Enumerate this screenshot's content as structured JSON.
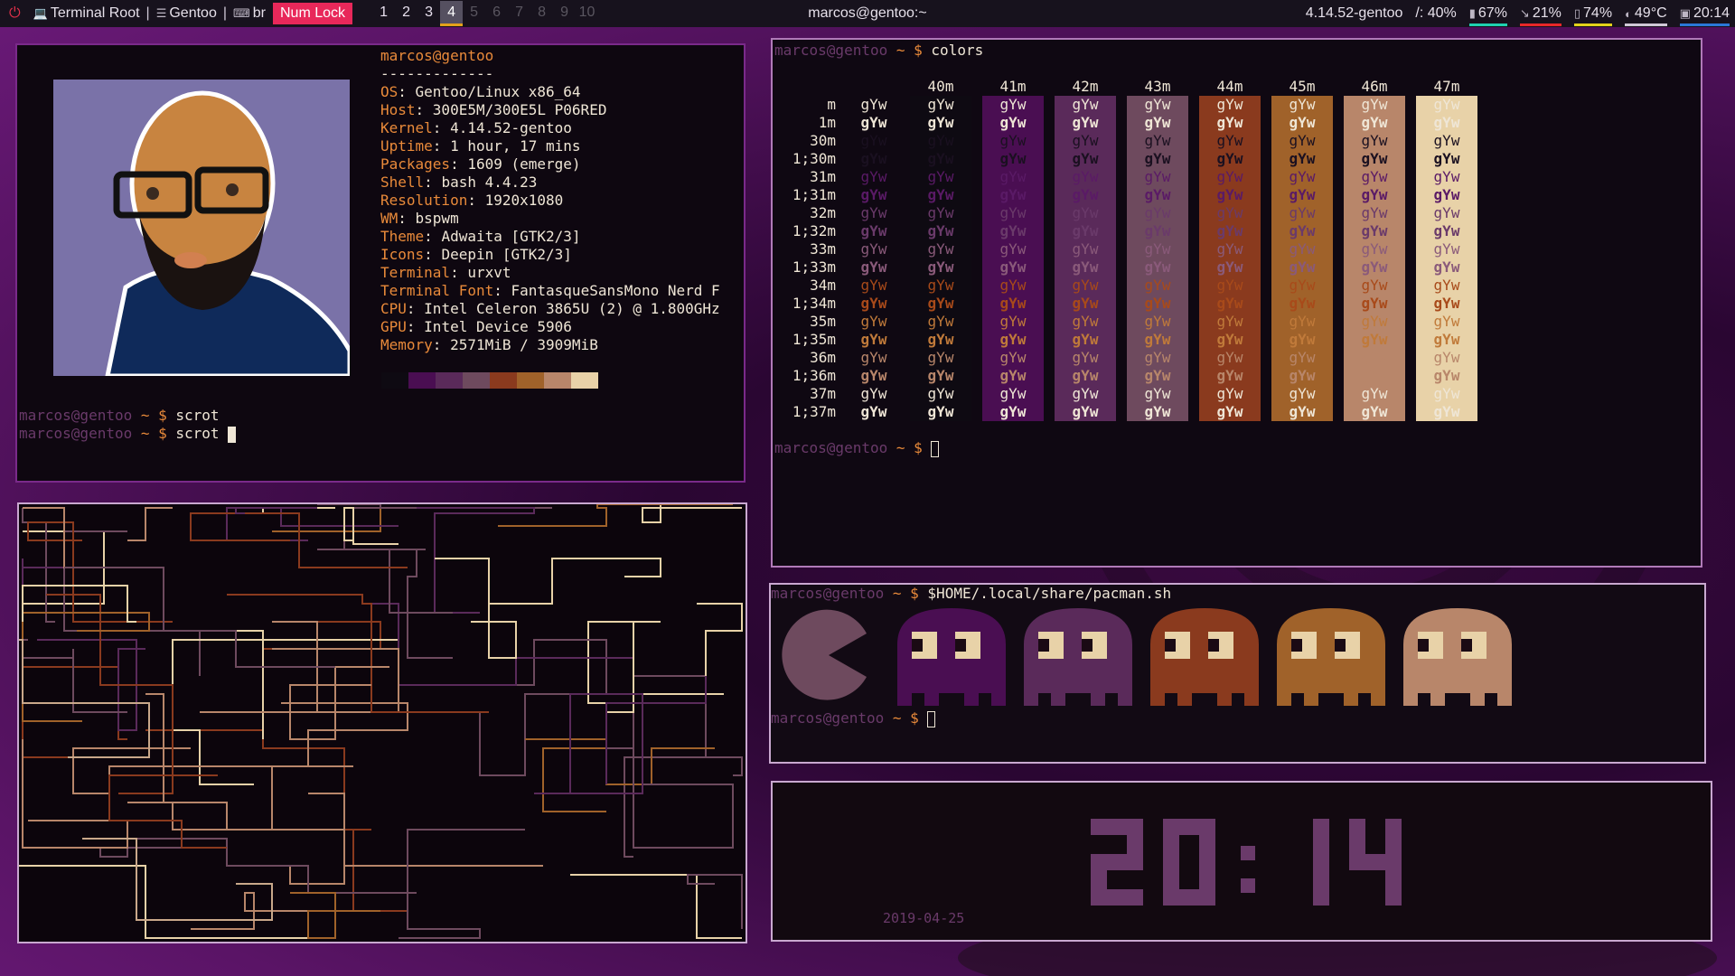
{
  "bar": {
    "window_title": "Terminal Root",
    "distro": "Gentoo",
    "layout": "br",
    "numlock": "Num Lock",
    "workspaces": [
      "1",
      "2",
      "3",
      "4",
      "5",
      "6",
      "7",
      "8",
      "9",
      "10"
    ],
    "active_workspace": "4",
    "occupied_workspaces": [
      "1",
      "2",
      "3",
      "4"
    ],
    "center_title": "marcos@gentoo:~",
    "kernel": "4.14.52-gentoo",
    "disk": "/: 40%",
    "cpu": "67%",
    "memory": "21%",
    "battery": "74%",
    "temperature": "49°C",
    "time": "20:14",
    "colors": {
      "numlock_bg": "#e8285a",
      "cpu": "#1fd1b0",
      "memory": "#e82828",
      "battery": "#e3d21a",
      "temperature": "#cfc8d6",
      "time": "#2a78d8",
      "active_ws": "#e3a21a",
      "power": "#e0304a"
    }
  },
  "neofetch": {
    "user_host": "marcos@gentoo",
    "separator": "-------------",
    "fields": [
      {
        "key": "OS",
        "value": "Gentoo/Linux x86_64"
      },
      {
        "key": "Host",
        "value": "300E5M/300E5L P06RED"
      },
      {
        "key": "Kernel",
        "value": "4.14.52-gentoo"
      },
      {
        "key": "Uptime",
        "value": "1 hour, 17 mins"
      },
      {
        "key": "Packages",
        "value": "1609 (emerge)"
      },
      {
        "key": "Shell",
        "value": "bash 4.4.23"
      },
      {
        "key": "Resolution",
        "value": "1920x1080"
      },
      {
        "key": "WM",
        "value": "bspwm"
      },
      {
        "key": "Theme",
        "value": "Adwaita [GTK2/3]"
      },
      {
        "key": "Icons",
        "value": "Deepin [GTK2/3]"
      },
      {
        "key": "Terminal",
        "value": "urxvt"
      },
      {
        "key": "Terminal Font",
        "value": "FantasqueSansMono Nerd F"
      },
      {
        "key": "CPU",
        "value": "Intel Celeron 3865U (2) @ 1.800GHz"
      },
      {
        "key": "GPU",
        "value": "Intel Device 5906"
      },
      {
        "key": "Memory",
        "value": "2571MiB / 3909MiB"
      }
    ],
    "palette": [
      "#0e0a12",
      "#4a0e52",
      "#5a2a5a",
      "#6e4a5e",
      "#8a3a1e",
      "#a0622a",
      "#b8866a",
      "#e8d2a8"
    ],
    "prompts": [
      {
        "user": "marcos@gentoo",
        "symbol": "~ $",
        "command": "scrot"
      },
      {
        "user": "marcos@gentoo",
        "symbol": "~ $",
        "command": "scrot"
      }
    ]
  },
  "colors_term": {
    "prompt": {
      "user": "marcos@gentoo",
      "symbol": "~ $",
      "command": "colors"
    },
    "prompt2": {
      "user": "marcos@gentoo",
      "symbol": "~ $"
    },
    "headers": [
      "40m",
      "41m",
      "42m",
      "43m",
      "44m",
      "45m",
      "46m",
      "47m"
    ],
    "sample": "gYw",
    "row_labels": [
      "m",
      "1m",
      "30m",
      "1;30m",
      "31m",
      "1;31m",
      "32m",
      "1;32m",
      "33m",
      "1;33m",
      "34m",
      "1;34m",
      "35m",
      "1;35m",
      "36m",
      "1;36m",
      "37m",
      "1;37m"
    ],
    "bg_colors": [
      "#0e0a12",
      "#4a0e52",
      "#5a2a5a",
      "#6e4a5e",
      "#8a3a1e",
      "#a0622a",
      "#b8866a",
      "#e8d2a8"
    ],
    "fg_colors": [
      "#efe6d6",
      "#1a1020",
      "#5a1a66",
      "#6a3a6a",
      "#8a5a7a",
      "#a84a1a",
      "#c07a3a",
      "#b8866a",
      "#efe6d6"
    ]
  },
  "pacman_term": {
    "prompt": {
      "user": "marcos@gentoo",
      "symbol": "~ $",
      "command": "$HOME/.local/share/pacman.sh"
    },
    "prompt2": {
      "user": "marcos@gentoo",
      "symbol": "~ $"
    },
    "pacman_color": "#6e4a5e",
    "ghost_colors": [
      "#4a0e52",
      "#5a2a5a",
      "#8a3a1e",
      "#a0622a",
      "#b8866a"
    ],
    "eye_color": "#e8d2a8"
  },
  "clock_term": {
    "time": "20:14",
    "date": "2019-04-25",
    "digit_color": "#6a3a6a"
  }
}
